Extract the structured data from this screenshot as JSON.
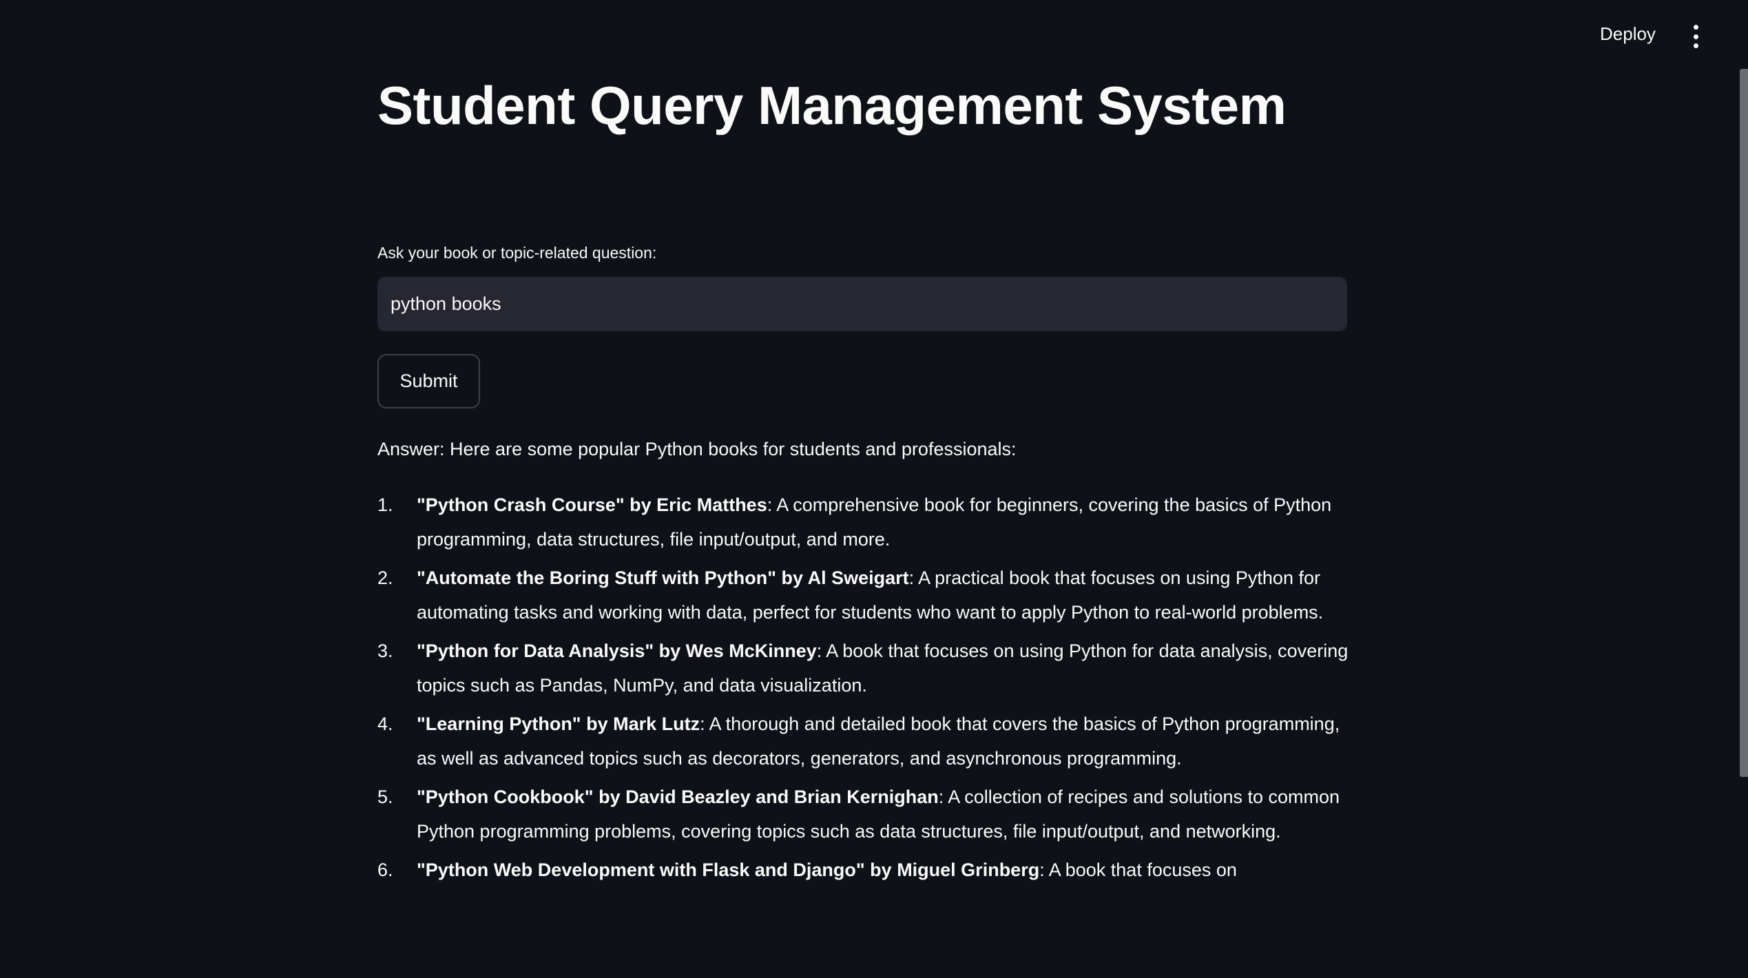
{
  "header": {
    "deploy_label": "Deploy",
    "menu_icon": "vertical-ellipsis-icon"
  },
  "page": {
    "title": "Student Query Management System",
    "input_label": "Ask your book or topic-related question:",
    "input_value": "python books",
    "submit_label": "Submit",
    "answer_intro": "Answer: Here are some popular Python books for students and professionals:",
    "items": [
      {
        "num": "1.",
        "title": "\"Python Crash Course\" by Eric Matthes",
        "desc": ": A comprehensive book for beginners, covering the basics of Python programming, data structures, file input/output, and more."
      },
      {
        "num": "2.",
        "title": "\"Automate the Boring Stuff with Python\" by Al Sweigart",
        "desc": ": A practical book that focuses on using Python for automating tasks and working with data, perfect for students who want to apply Python to real-world problems."
      },
      {
        "num": "3.",
        "title": "\"Python for Data Analysis\" by Wes McKinney",
        "desc": ": A book that focuses on using Python for data analysis, covering topics such as Pandas, NumPy, and data visualization."
      },
      {
        "num": "4.",
        "title": "\"Learning Python\" by Mark Lutz",
        "desc": ": A thorough and detailed book that covers the basics of Python programming, as well as advanced topics such as decorators, generators, and asynchronous programming."
      },
      {
        "num": "5.",
        "title": "\"Python Cookbook\" by David Beazley and Brian Kernighan",
        "desc": ": A collection of recipes and solutions to common Python programming problems, covering topics such as data structures, file input/output, and networking."
      },
      {
        "num": "6.",
        "title": "\"Python Web Development with Flask and Django\" by Miguel Grinberg",
        "desc": ": A book that focuses on"
      }
    ]
  },
  "colors": {
    "background": "#0e1117",
    "input_bg": "#262730",
    "text": "#fafafa"
  }
}
